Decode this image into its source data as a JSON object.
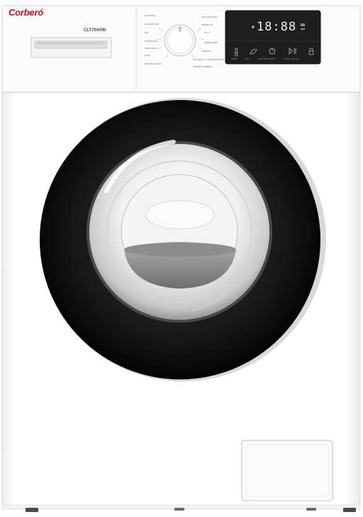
{
  "brand": "Corberó",
  "model": "CLT704VIN",
  "display": "18:88",
  "program_labels_left": [
    "ALGODÓN",
    "ALGODÓN 20°",
    "MIX",
    "SINTÉTICOS",
    "DELICADOS",
    "LANA",
    "CENTRIFUGADO"
  ],
  "program_labels_right": [
    "ALGODÓN ECO",
    "RÁPIDO 15'",
    "20 °C",
    "EDREDONES",
    "CAMISAS",
    "ACLARADO + CENTRIFUGADO",
    "LIMPIEZA TAMBOR"
  ],
  "panel_buttons": [
    "TEMP.",
    "ECO",
    "CENTRIFUGADO",
    "INICIO / PAUSA"
  ],
  "colors": {
    "brand": "#d0121b",
    "display": "#1e1e1e",
    "door_ring": "#0d0d0d",
    "body": "#ffffff"
  },
  "icons": [
    "knob-icon",
    "temperature-icon",
    "eco-icon",
    "spin-icon",
    "start-pause-icon",
    "lock-icon"
  ]
}
